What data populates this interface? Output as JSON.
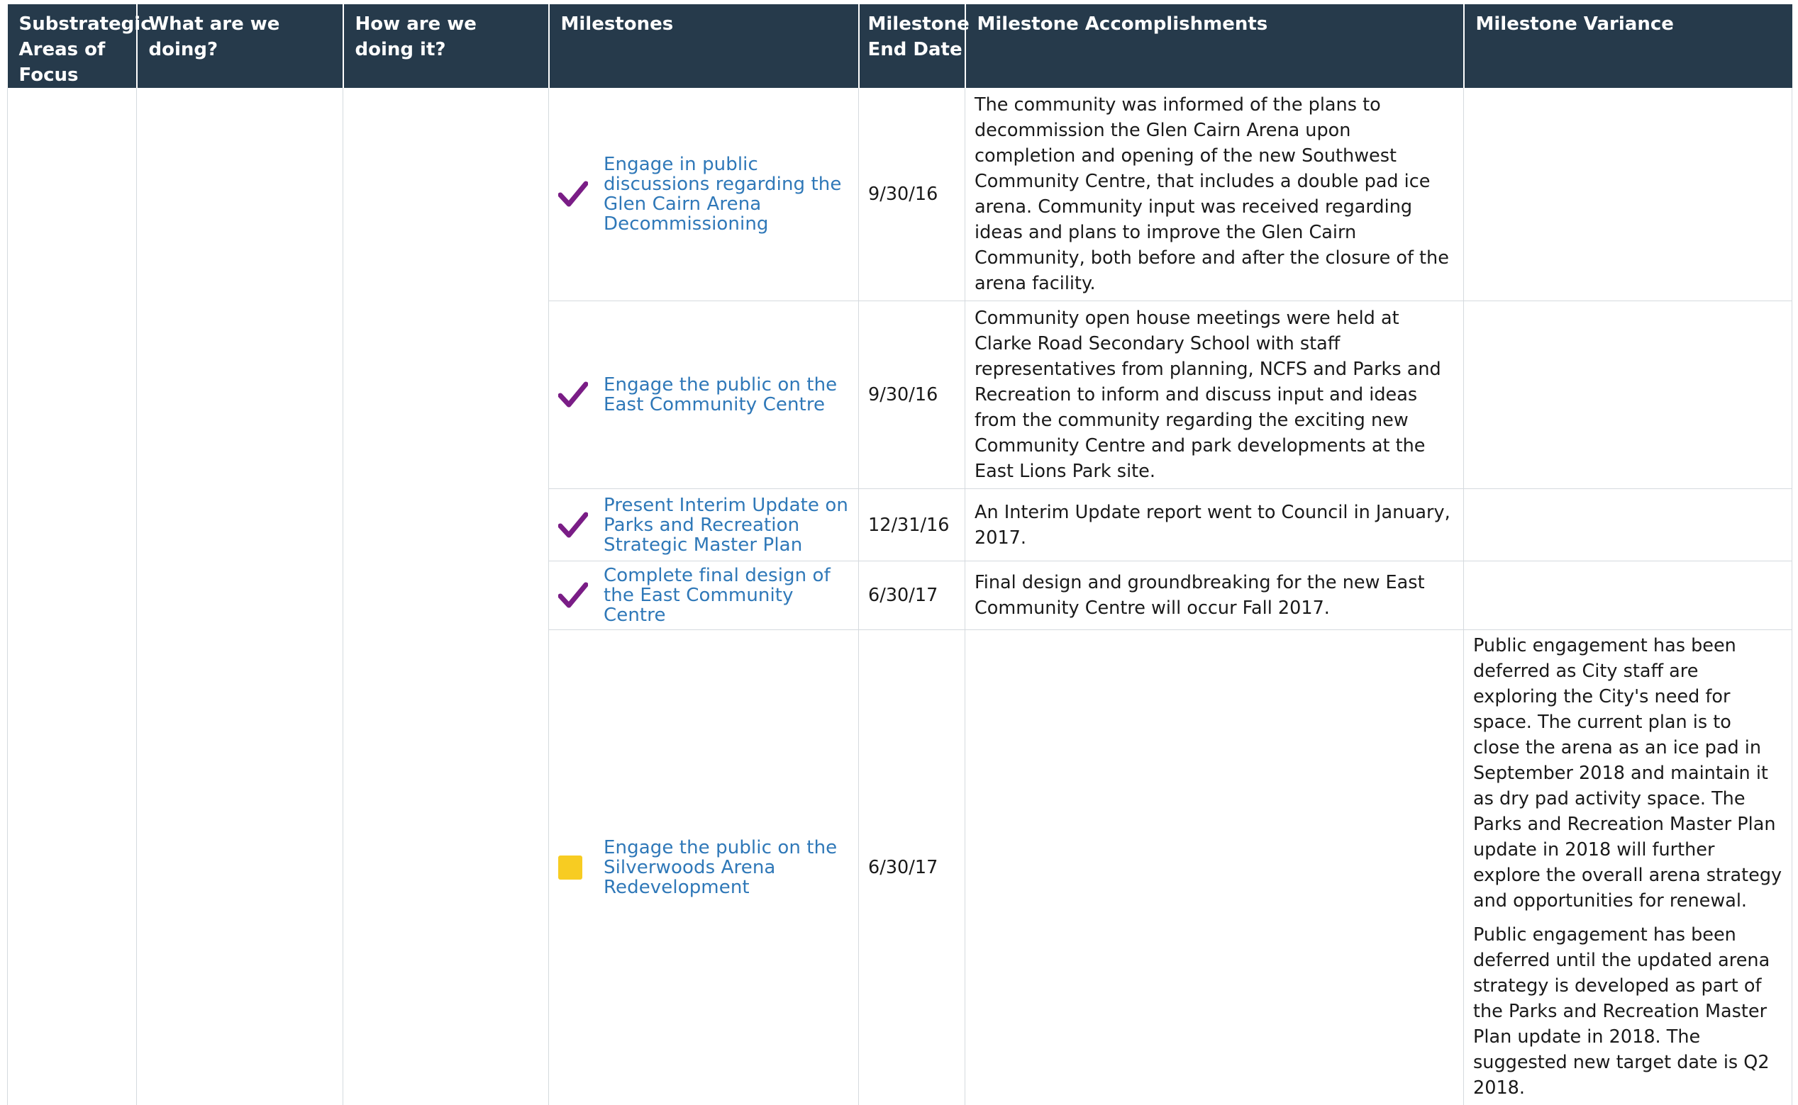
{
  "table": {
    "headers": [
      "Substrategic Areas of Focus",
      "What are we doing?",
      "How are we doing it?",
      "Milestones",
      "Milestone End Date",
      "Milestone Accomplishments",
      "Milestone Variance"
    ],
    "rows": [
      {
        "status": "complete",
        "status_icon": "checkmark-icon",
        "milestone": "Engage in public discussions regarding the Glen Cairn Arena Decommissioning",
        "end_date": "9/30/16",
        "accomplishment": "The community was informed of the plans to decommission the Glen Cairn Arena upon completion and opening of the new Southwest Community Centre, that includes a double pad ice arena. Community input was received regarding ideas and plans to improve the Glen Cairn Community, both before and after the closure of the arena facility.",
        "variance": []
      },
      {
        "status": "complete",
        "status_icon": "checkmark-icon",
        "milestone": "Engage the public on the East Community Centre",
        "end_date": "9/30/16",
        "accomplishment": "Community open house meetings were held at Clarke Road Secondary School with staff representatives from planning, NCFS and Parks and Recreation to inform and discuss input and ideas from the community regarding the exciting new Community Centre and park developments at the East Lions Park site.",
        "variance": []
      },
      {
        "status": "complete",
        "status_icon": "checkmark-icon",
        "milestone": "Present Interim Update on Parks and Recreation Strategic Master Plan",
        "end_date": "12/31/16",
        "accomplishment": "An Interim Update report went to Council in January, 2017.",
        "variance": []
      },
      {
        "status": "complete",
        "status_icon": "checkmark-icon",
        "milestone": "Complete final design of the East Community Centre",
        "end_date": "6/30/17",
        "accomplishment": "Final design and groundbreaking for the new East Community Centre will occur Fall 2017.",
        "variance": []
      },
      {
        "status": "caution",
        "status_icon": "yellow-square-icon",
        "milestone": "Engage the public on the Silverwoods Arena Redevelopment",
        "end_date": "6/30/17",
        "accomplishment": "",
        "variance": [
          "Public engagement has been deferred as City staff are exploring the City's need for space. The current plan is to close the arena as an ice pad in September 2018 and maintain it as dry pad activity space. The Parks and Recreation Master Plan update in 2018 will further explore the overall arena strategy and opportunities for renewal.",
          "Public engagement has been deferred until the updated arena strategy is developed as part of the Parks and Recreation Master Plan update in 2018. The suggested new target date is Q2 2018."
        ]
      }
    ]
  },
  "colors": {
    "header_bg": "#263a4b",
    "header_text": "#ffffff",
    "link": "#2f78b8",
    "check": "#7a1d86",
    "caution": "#f7cc22",
    "grid": "#d5dade"
  }
}
